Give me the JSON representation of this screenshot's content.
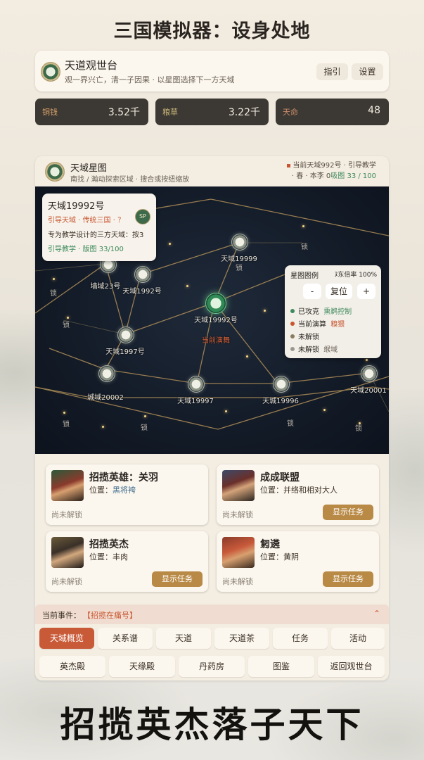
{
  "headline": "三国模拟器：设身处地",
  "top_card": {
    "title": "天道观世台",
    "subtitle": "观一界兴亡，清一子因果 · 以星图选择下一方天域",
    "guide_label": "指引",
    "settings_label": "设置"
  },
  "stats": [
    {
      "label": "铜钱",
      "value": "3.52千"
    },
    {
      "label": "粮草",
      "value": "3.22千"
    },
    {
      "label": "天命",
      "value": "48"
    }
  ],
  "starmap": {
    "title": "天域星图",
    "subtitle": "南找 / 瀚动探索区域 · 搜合或按纽缩放",
    "current_label": "当前天域992号 · 引导教学",
    "season_line": "· 春 · 本李 0",
    "territory_label": "吸图 33 / 100",
    "nodes": [
      {
        "label": "天域19999",
        "sub": "锁"
      },
      {
        "label": "墙域23号",
        "sub": ""
      },
      {
        "label": "天域1992号",
        "sub": ""
      },
      {
        "label": "天域19992号",
        "sub": ""
      },
      {
        "label": "天域1997号",
        "sub": ""
      },
      {
        "label": "城域20002",
        "sub": ""
      },
      {
        "label": "天域19997",
        "sub": ""
      },
      {
        "label": "天城19996",
        "sub": ""
      },
      {
        "label": "天域20001",
        "sub": ""
      }
    ],
    "lock_text": "锁",
    "drama_label": "当前演舞",
    "tooltip": {
      "title": "天域19992号",
      "line1": "引导天域 · 传统三国 · ？",
      "badge": "SP",
      "line2": "专为教学设计的三方天域：按3",
      "line3": "引导教学 · 版图 33/100"
    },
    "legend": {
      "title": "星图图例",
      "zoom_label": "ﾇ东倍率 100%",
      "minus": "-",
      "reset": "复位",
      "plus": "+",
      "items": [
        {
          "label": "已攻克",
          "note": "熏鹈控制",
          "color": "#3f8a5c"
        },
        {
          "label": "当前演算",
          "note": "糗猥",
          "color": "#c8552f"
        },
        {
          "label": "未解锁",
          "note": "",
          "color": "#8a7a5e"
        },
        {
          "label": "未解锁",
          "note": "缑域",
          "color": "#9a9690"
        }
      ]
    }
  },
  "tasks": [
    {
      "title": "招揽英雄：关羽",
      "position_label": "位置：",
      "position": "黑将袴",
      "status": "尚未解锁",
      "button": ""
    },
    {
      "title": "成成联盟",
      "position_label": "位置：",
      "position": "并络和相对大人",
      "status": "尚未解锁",
      "button": "显示任务"
    },
    {
      "title": "招揽英杰",
      "position_label": "位置：",
      "position": "丰肉",
      "status": "尚未解锁",
      "button": "显示任务"
    },
    {
      "title": "匑遴",
      "position_label": "位置：",
      "position": "黄阴",
      "status": "尚未解锁",
      "button": "显示任务"
    }
  ],
  "event_bar": {
    "label": "当前事件：",
    "value": "【招揽在痛号】",
    "chevron": "⌃"
  },
  "nav_row1": [
    "天域概览",
    "关系谱",
    "天道",
    "天道茶",
    "任务",
    "活动"
  ],
  "nav_row2": [
    "英杰殿",
    "天缘殿",
    "丹药房",
    "图鉴",
    "返回观世台"
  ],
  "slogan": "招揽英杰落子天下",
  "colors": {
    "accent": "#c95a38",
    "gold": "#b98a46",
    "dark": "#3c3833"
  }
}
